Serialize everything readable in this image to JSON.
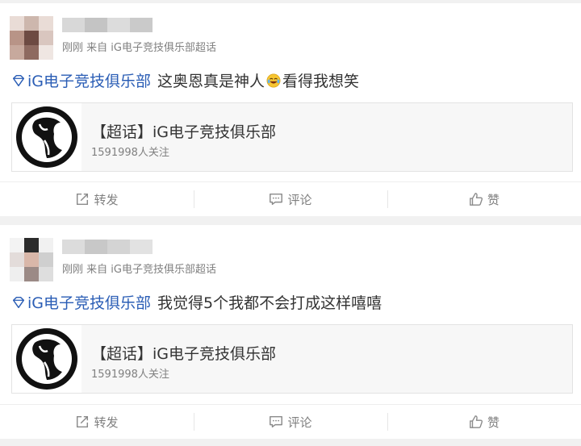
{
  "posts": [
    {
      "meta": "刚刚 来自 iG电子竞技俱乐部超话",
      "topic": "iG电子竞技俱乐部",
      "text_before": "这奥恩真是神人",
      "emoji": "laughing-crying-emoji",
      "text_after": "看得我想笑",
      "card": {
        "title": "【超话】iG电子竞技俱乐部",
        "subtitle": "1591998人关注"
      },
      "actions": {
        "repost": "转发",
        "comment": "评论",
        "like": "赞"
      }
    },
    {
      "meta": "刚刚 来自 iG电子竞技俱乐部超话",
      "topic": "iG电子竞技俱乐部",
      "text_before": "我觉得5个我都不会打成这样嘻嘻",
      "emoji": "",
      "text_after": "",
      "card": {
        "title": "【超话】iG电子竞技俱乐部",
        "subtitle": "1591998人关注"
      },
      "actions": {
        "repost": "转发",
        "comment": "评论",
        "like": "赞"
      }
    }
  ],
  "colors": {
    "topic_link": "#2a5db5",
    "meta_text": "#808080",
    "page_bg": "#f1f1f1"
  }
}
